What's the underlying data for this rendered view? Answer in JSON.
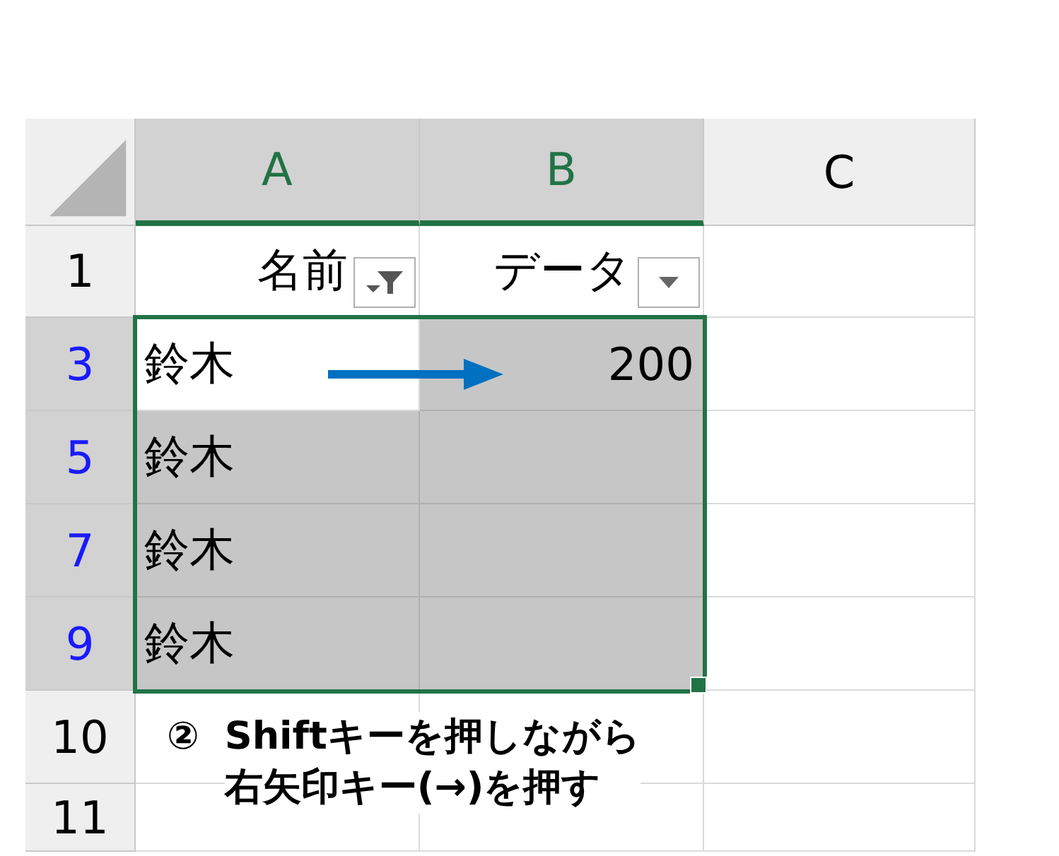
{
  "columns": [
    {
      "label": "A",
      "selected": true
    },
    {
      "label": "B",
      "selected": true
    },
    {
      "label": "C",
      "selected": false
    }
  ],
  "header_row": {
    "number": "1",
    "cells": [
      {
        "text": "名前",
        "filter_applied": true
      },
      {
        "text": "データ",
        "filter_applied": false
      }
    ]
  },
  "rows": [
    {
      "number": "3",
      "filtered": true,
      "selected": true,
      "cells": [
        {
          "text": "鈴木",
          "kind": "text",
          "selected": false
        },
        {
          "text": "200",
          "kind": "number",
          "selected": true
        },
        {
          "selected": false
        }
      ]
    },
    {
      "number": "5",
      "filtered": true,
      "selected": true,
      "cells": [
        {
          "text": "鈴木",
          "kind": "text",
          "selected": true
        },
        {
          "selected": true
        },
        {
          "selected": false
        }
      ]
    },
    {
      "number": "7",
      "filtered": true,
      "selected": true,
      "cells": [
        {
          "text": "鈴木",
          "kind": "text",
          "selected": true
        },
        {
          "selected": true
        },
        {
          "selected": false
        }
      ]
    },
    {
      "number": "9",
      "filtered": true,
      "selected": true,
      "cells": [
        {
          "text": "鈴木",
          "kind": "text",
          "selected": true
        },
        {
          "selected": true
        },
        {
          "selected": false
        }
      ]
    },
    {
      "number": "10",
      "filtered": false,
      "selected": false,
      "cells": [
        {
          "selected": false
        },
        {
          "selected": false
        },
        {
          "selected": false
        }
      ]
    },
    {
      "number": "11",
      "filtered": false,
      "selected": false,
      "cells": [
        {
          "selected": false
        },
        {
          "selected": false
        },
        {
          "selected": false
        }
      ]
    }
  ],
  "annotation": {
    "marker": "②",
    "lines": [
      "Shiftキーを押しながら",
      "右矢印キー(→)を押す"
    ]
  }
}
